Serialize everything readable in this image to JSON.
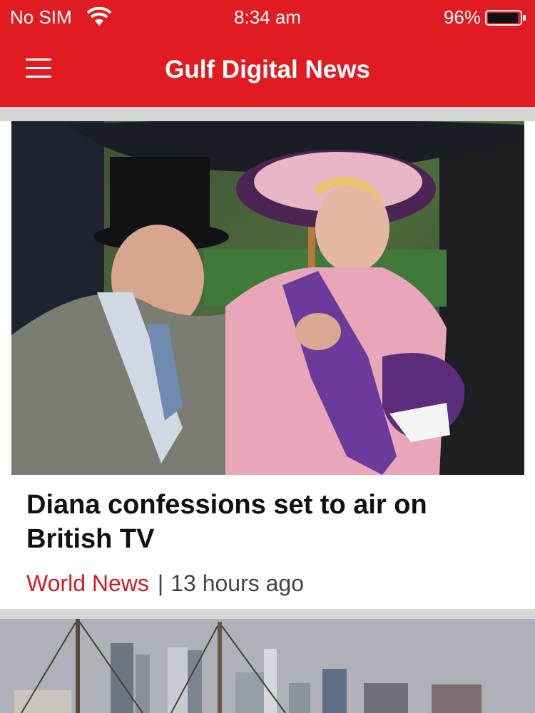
{
  "status_bar": {
    "carrier": "No SIM",
    "time": "8:34 am",
    "battery_percent": "96%",
    "battery_level": 0.96,
    "wifi_icon": "wifi-icon",
    "battery_icon": "battery-icon"
  },
  "header": {
    "title": "Gulf Digital News",
    "menu_icon": "hamburger-menu-icon"
  },
  "colors": {
    "brand_red": "#e11b22",
    "category_red": "#d41a20",
    "feed_background": "#d6d6d6"
  },
  "articles": [
    {
      "headline": "Diana confessions set to air on British TV",
      "category": "World News",
      "separator": "|",
      "time_ago": "13 hours ago"
    }
  ]
}
